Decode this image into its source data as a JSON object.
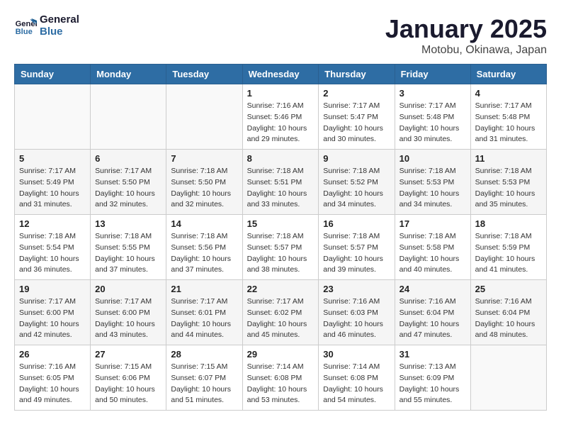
{
  "header": {
    "logo_line1": "General",
    "logo_line2": "Blue",
    "month": "January 2025",
    "location": "Motobu, Okinawa, Japan"
  },
  "days_of_week": [
    "Sunday",
    "Monday",
    "Tuesday",
    "Wednesday",
    "Thursday",
    "Friday",
    "Saturday"
  ],
  "weeks": [
    [
      {
        "day": "",
        "info": ""
      },
      {
        "day": "",
        "info": ""
      },
      {
        "day": "",
        "info": ""
      },
      {
        "day": "1",
        "info": "Sunrise: 7:16 AM\nSunset: 5:46 PM\nDaylight: 10 hours\nand 29 minutes."
      },
      {
        "day": "2",
        "info": "Sunrise: 7:17 AM\nSunset: 5:47 PM\nDaylight: 10 hours\nand 30 minutes."
      },
      {
        "day": "3",
        "info": "Sunrise: 7:17 AM\nSunset: 5:48 PM\nDaylight: 10 hours\nand 30 minutes."
      },
      {
        "day": "4",
        "info": "Sunrise: 7:17 AM\nSunset: 5:48 PM\nDaylight: 10 hours\nand 31 minutes."
      }
    ],
    [
      {
        "day": "5",
        "info": "Sunrise: 7:17 AM\nSunset: 5:49 PM\nDaylight: 10 hours\nand 31 minutes."
      },
      {
        "day": "6",
        "info": "Sunrise: 7:17 AM\nSunset: 5:50 PM\nDaylight: 10 hours\nand 32 minutes."
      },
      {
        "day": "7",
        "info": "Sunrise: 7:18 AM\nSunset: 5:50 PM\nDaylight: 10 hours\nand 32 minutes."
      },
      {
        "day": "8",
        "info": "Sunrise: 7:18 AM\nSunset: 5:51 PM\nDaylight: 10 hours\nand 33 minutes."
      },
      {
        "day": "9",
        "info": "Sunrise: 7:18 AM\nSunset: 5:52 PM\nDaylight: 10 hours\nand 34 minutes."
      },
      {
        "day": "10",
        "info": "Sunrise: 7:18 AM\nSunset: 5:53 PM\nDaylight: 10 hours\nand 34 minutes."
      },
      {
        "day": "11",
        "info": "Sunrise: 7:18 AM\nSunset: 5:53 PM\nDaylight: 10 hours\nand 35 minutes."
      }
    ],
    [
      {
        "day": "12",
        "info": "Sunrise: 7:18 AM\nSunset: 5:54 PM\nDaylight: 10 hours\nand 36 minutes."
      },
      {
        "day": "13",
        "info": "Sunrise: 7:18 AM\nSunset: 5:55 PM\nDaylight: 10 hours\nand 37 minutes."
      },
      {
        "day": "14",
        "info": "Sunrise: 7:18 AM\nSunset: 5:56 PM\nDaylight: 10 hours\nand 37 minutes."
      },
      {
        "day": "15",
        "info": "Sunrise: 7:18 AM\nSunset: 5:57 PM\nDaylight: 10 hours\nand 38 minutes."
      },
      {
        "day": "16",
        "info": "Sunrise: 7:18 AM\nSunset: 5:57 PM\nDaylight: 10 hours\nand 39 minutes."
      },
      {
        "day": "17",
        "info": "Sunrise: 7:18 AM\nSunset: 5:58 PM\nDaylight: 10 hours\nand 40 minutes."
      },
      {
        "day": "18",
        "info": "Sunrise: 7:18 AM\nSunset: 5:59 PM\nDaylight: 10 hours\nand 41 minutes."
      }
    ],
    [
      {
        "day": "19",
        "info": "Sunrise: 7:17 AM\nSunset: 6:00 PM\nDaylight: 10 hours\nand 42 minutes."
      },
      {
        "day": "20",
        "info": "Sunrise: 7:17 AM\nSunset: 6:00 PM\nDaylight: 10 hours\nand 43 minutes."
      },
      {
        "day": "21",
        "info": "Sunrise: 7:17 AM\nSunset: 6:01 PM\nDaylight: 10 hours\nand 44 minutes."
      },
      {
        "day": "22",
        "info": "Sunrise: 7:17 AM\nSunset: 6:02 PM\nDaylight: 10 hours\nand 45 minutes."
      },
      {
        "day": "23",
        "info": "Sunrise: 7:16 AM\nSunset: 6:03 PM\nDaylight: 10 hours\nand 46 minutes."
      },
      {
        "day": "24",
        "info": "Sunrise: 7:16 AM\nSunset: 6:04 PM\nDaylight: 10 hours\nand 47 minutes."
      },
      {
        "day": "25",
        "info": "Sunrise: 7:16 AM\nSunset: 6:04 PM\nDaylight: 10 hours\nand 48 minutes."
      }
    ],
    [
      {
        "day": "26",
        "info": "Sunrise: 7:16 AM\nSunset: 6:05 PM\nDaylight: 10 hours\nand 49 minutes."
      },
      {
        "day": "27",
        "info": "Sunrise: 7:15 AM\nSunset: 6:06 PM\nDaylight: 10 hours\nand 50 minutes."
      },
      {
        "day": "28",
        "info": "Sunrise: 7:15 AM\nSunset: 6:07 PM\nDaylight: 10 hours\nand 51 minutes."
      },
      {
        "day": "29",
        "info": "Sunrise: 7:14 AM\nSunset: 6:08 PM\nDaylight: 10 hours\nand 53 minutes."
      },
      {
        "day": "30",
        "info": "Sunrise: 7:14 AM\nSunset: 6:08 PM\nDaylight: 10 hours\nand 54 minutes."
      },
      {
        "day": "31",
        "info": "Sunrise: 7:13 AM\nSunset: 6:09 PM\nDaylight: 10 hours\nand 55 minutes."
      },
      {
        "day": "",
        "info": ""
      }
    ]
  ]
}
